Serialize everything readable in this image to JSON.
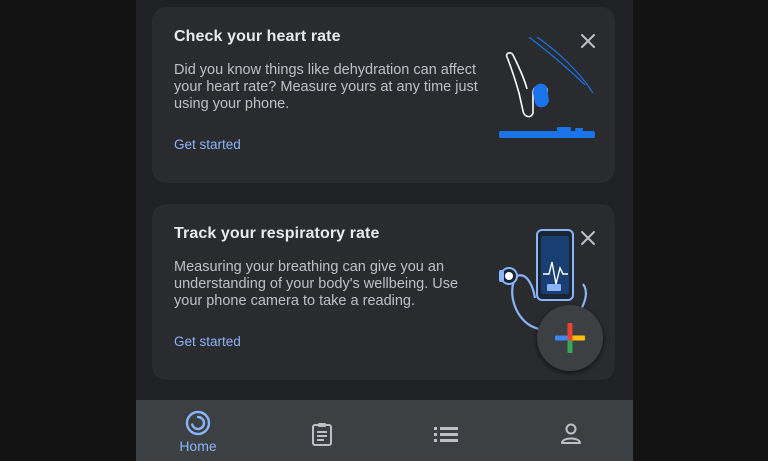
{
  "cards": [
    {
      "title": "Check your heart rate",
      "body": "Did you know things like dehydration can affect your heart rate? Measure yours at any time just using your phone.",
      "link": "Get started",
      "illustration": "finger-on-camera-illustration"
    },
    {
      "title": "Track your respiratory rate",
      "body": "Measuring your breathing can give you an understanding of your body's wellbeing. Use your phone camera to take a reading.",
      "link": "Get started",
      "illustration": "stethoscope-phone-illustration"
    }
  ],
  "fab": {
    "icon": "plus-icon",
    "colors": [
      "#4285f4",
      "#ea4335",
      "#fbbc05",
      "#34a853"
    ]
  },
  "nav": {
    "items": [
      {
        "label": "Home",
        "icon": "home-icon",
        "active": true
      },
      {
        "label": "",
        "icon": "journal-icon",
        "active": false
      },
      {
        "label": "",
        "icon": "browse-list-icon",
        "active": false
      },
      {
        "label": "",
        "icon": "profile-icon",
        "active": false
      }
    ]
  },
  "colors": {
    "background": "#202124",
    "card": "#2a2b2f",
    "accent": "#8ab4f8",
    "illustration_blue": "#1a73e8",
    "nav_bar": "#3c4043"
  }
}
